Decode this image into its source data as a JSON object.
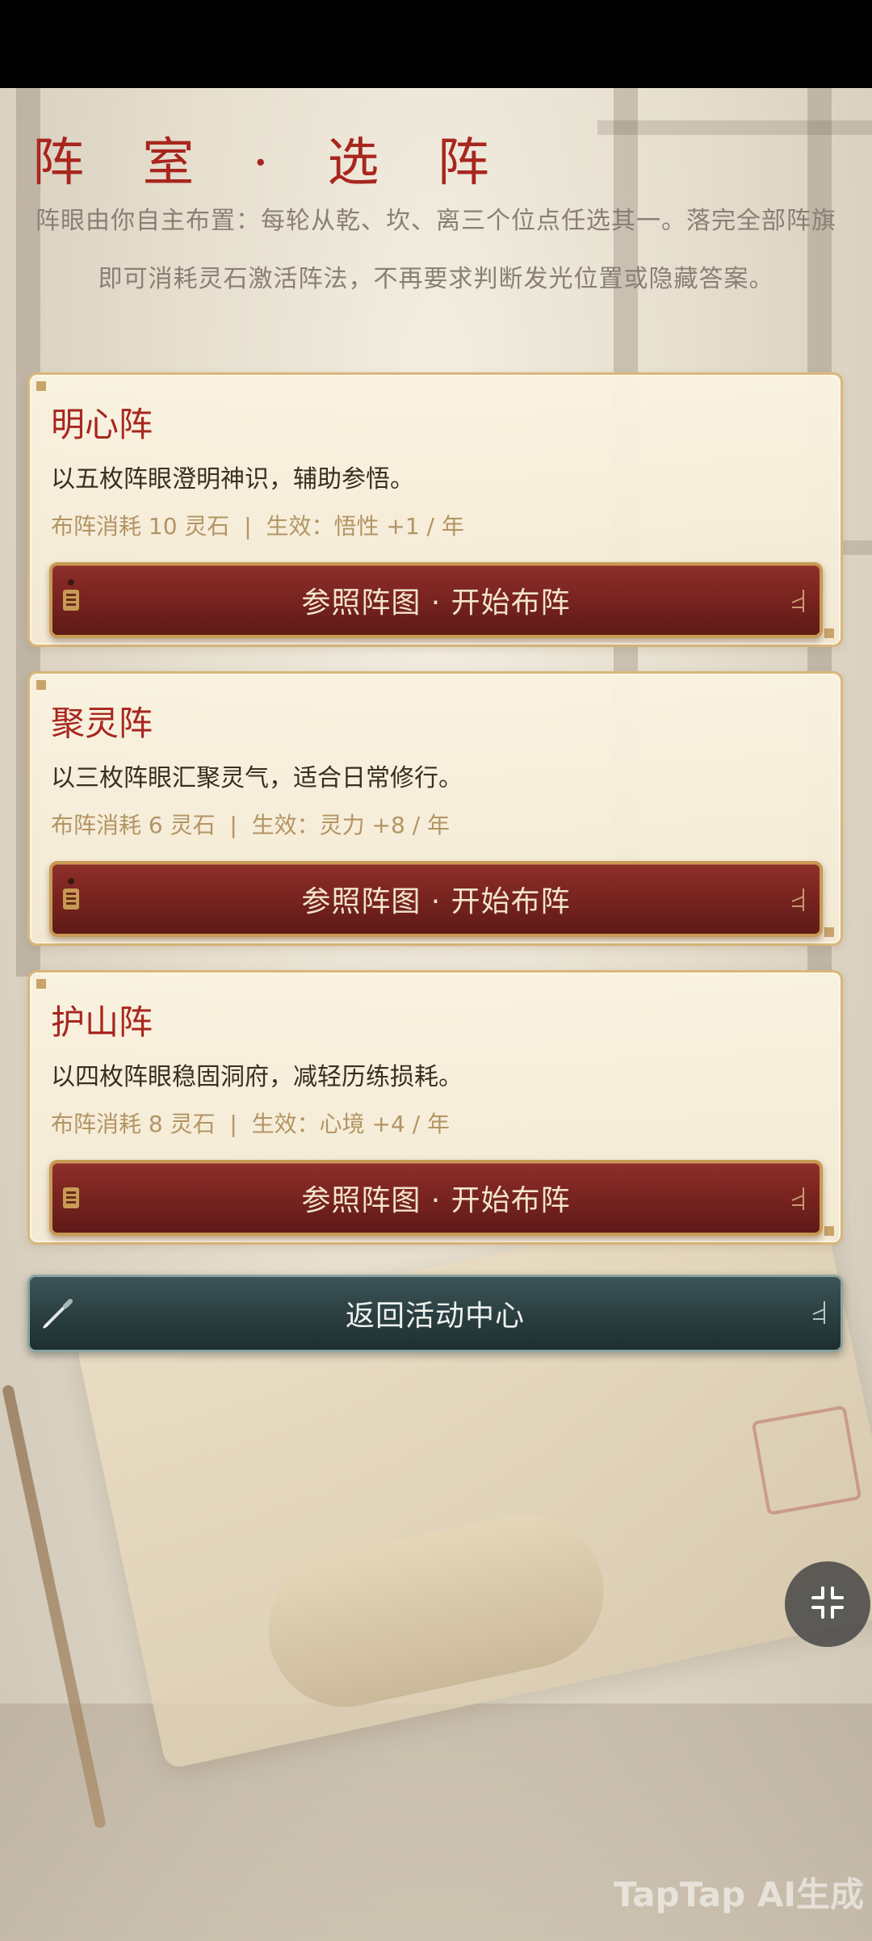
{
  "header": {
    "title": "阵 室 · 选 阵",
    "intro": "阵眼由你自主布置：每轮从乾、坎、离三个位点任选其一。落完全部阵旗即可消耗灵石激活阵法，不再要求判断发光位置或隐藏答案。"
  },
  "formations": [
    {
      "name": "明心阵",
      "description": "以五枚阵眼澄明神识，辅助参悟。",
      "meta": "布阵消耗 10 灵石  |  生效：悟性 +1 / 年",
      "button_label": "参照阵图 · 开始布阵"
    },
    {
      "name": "聚灵阵",
      "description": "以三枚阵眼汇聚灵气，适合日常修行。",
      "meta": "布阵消耗 6 灵石  |  生效：灵力 +8 / 年",
      "button_label": "参照阵图 · 开始布阵"
    },
    {
      "name": "护山阵",
      "description": "以四枚阵眼稳固洞府，减轻历练损耗。",
      "meta": "布阵消耗 8 灵石  |  生效：心境 +4 / 年",
      "button_label": "参照阵图 · 开始布阵"
    }
  ],
  "return_button": {
    "label": "返回活动中心"
  },
  "watermark": "TapTap AI生成",
  "colors": {
    "title_red": "#a8261e",
    "button_red": "#7a2420",
    "button_border_gold": "#c99a52",
    "return_teal": "#2a3e40",
    "meta_gold": "#b39464"
  },
  "icons": {
    "button_left": "scroll-tag-icon",
    "button_right": "tassel-icon",
    "return_left": "brush-pen-icon",
    "floating": "collapse-arrows-icon"
  }
}
